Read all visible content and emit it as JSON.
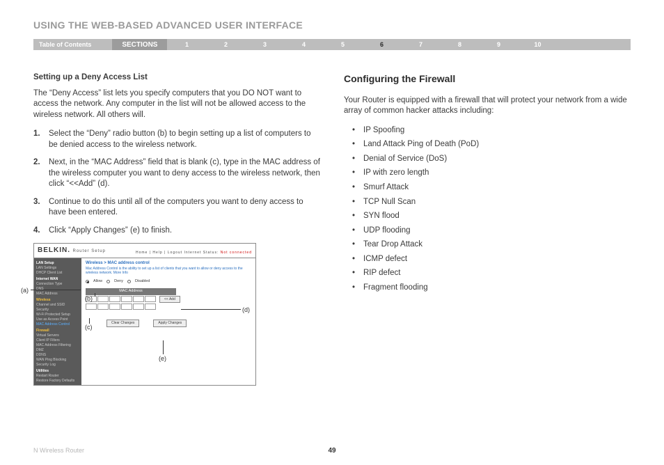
{
  "header": {
    "title": "USING THE WEB-BASED ADVANCED USER INTERFACE",
    "toc": "Table of Contents",
    "sections_label": "SECTIONS",
    "sections": [
      "1",
      "2",
      "3",
      "4",
      "5",
      "6",
      "7",
      "8",
      "9",
      "10"
    ],
    "active_section": "6"
  },
  "left": {
    "subhead": "Setting up a Deny Access List",
    "intro": "The “Deny Access” list lets you specify computers that you DO NOT want to access the network. Any computer in the list will not be allowed access to the wireless network. All others will.",
    "steps": [
      "Select the “Deny” radio button (b) to begin setting up a list of computers to be denied access to the wireless network.",
      "Next, in the “MAC Address” field that is blank (c), type in the MAC address of the wireless computer you want to deny access to the wireless network, then click “<<Add” (d).",
      "Continue to do this until all of the computers you want to deny access to have been entered.",
      "Click “Apply Changes” (e) to finish."
    ]
  },
  "right": {
    "heading": "Configuring the Firewall",
    "intro": "Your Router is equipped with a firewall that will protect your network from a wide array of common hacker attacks including:",
    "attacks": [
      "IP Spoofing",
      "Land Attack Ping of Death (PoD)",
      "Denial of Service (DoS)",
      "IP with zero length",
      "Smurf Attack",
      "TCP Null Scan",
      "SYN flood",
      "UDP flooding",
      "Tear Drop Attack",
      "ICMP defect",
      "RIP defect",
      "Fragment flooding"
    ]
  },
  "shot": {
    "brand": "BELKIN.",
    "brand_sub": "Router Setup",
    "toplinks": "Home | Help | Logout   Internet Status:",
    "not_connected": "Not connected",
    "side": {
      "g1": "LAN Setup",
      "i1": [
        "LAN Settings",
        "DHCP Client List"
      ],
      "g2": "Internet WAN",
      "i2": [
        "Connection Type",
        "DNS",
        "MAC Address"
      ],
      "g3": "Wireless",
      "i3": [
        "Channel and SSID",
        "Security",
        "Wi-Fi Protected Setup",
        "Use as Access Point"
      ],
      "i3b": "MAC Address Control",
      "g4": "Firewall",
      "i4": [
        "Virtual Servers",
        "Client IP Filters",
        "MAC Address Filtering",
        "DMZ",
        "DDNS",
        "WAN Ping Blocking",
        "Security Log"
      ],
      "g5": "Utilities",
      "i5": [
        "Restart Router",
        "Restore Factory Defaults"
      ]
    },
    "main": {
      "title": "Wireless > MAC address control",
      "desc": "Mac Address Control is the ability to set up a list of clients that you want to allow or deny access to the wireless network. More Info",
      "radio_allow": "Allow",
      "radio_deny": "Deny",
      "radio_disabled": "Disabled",
      "mac_head": "MAC Address",
      "add": "<< Add",
      "clear": "Clear Changes",
      "apply": "Apply Changes"
    },
    "annot": {
      "a": "(a)",
      "b": "(b)",
      "c": "(c)",
      "d": "(d)",
      "e": "(e)"
    }
  },
  "footer": {
    "product": "N Wireless Router",
    "page": "49"
  }
}
